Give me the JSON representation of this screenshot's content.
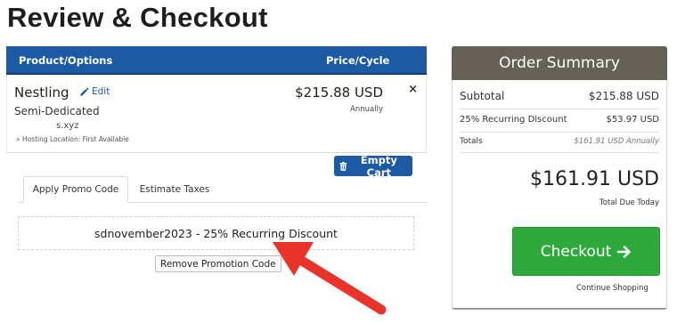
{
  "page": {
    "title": "Review & Checkout"
  },
  "cart": {
    "header": {
      "product_col": "Product/Options",
      "price_col": "Price/Cycle"
    },
    "item": {
      "name": "Nestling",
      "edit_label": "Edit",
      "group": "Semi-Dedicated",
      "domain": "s.xyz",
      "location": "» Hosting Location: First Available",
      "price": "$215.88 USD",
      "cycle": "Annually",
      "remove_label": "×"
    },
    "empty_cart_label": "Empty Cart"
  },
  "tabs": [
    {
      "label": "Apply Promo Code",
      "active": true
    },
    {
      "label": "Estimate Taxes",
      "active": false
    }
  ],
  "promo": {
    "applied_text": "sdnovember2023 - 25% Recurring Discount",
    "remove_label": "Remove Promotion Code"
  },
  "summary": {
    "title": "Order Summary",
    "subtotal_label": "Subtotal",
    "subtotal_value": "$215.88 USD",
    "discount_label": "25% Recurring Discount",
    "discount_value": "$53.97 USD",
    "totals_label": "Totals",
    "totals_value": "$161.91 USD Annually",
    "total_due": "$161.91 USD",
    "total_due_caption": "Total Due Today",
    "checkout_label": "Checkout",
    "continue_label": "Continue Shopping"
  },
  "colors": {
    "primary": "#1c5aa3",
    "summary_header": "#666156",
    "checkout": "#2eaa3c",
    "annotation_arrow": "#e8332b"
  },
  "icons": {
    "edit": "pencil-icon",
    "empty_cart": "trash-icon",
    "checkout": "arrow-right-icon",
    "annotation": "red-arrow-icon"
  }
}
